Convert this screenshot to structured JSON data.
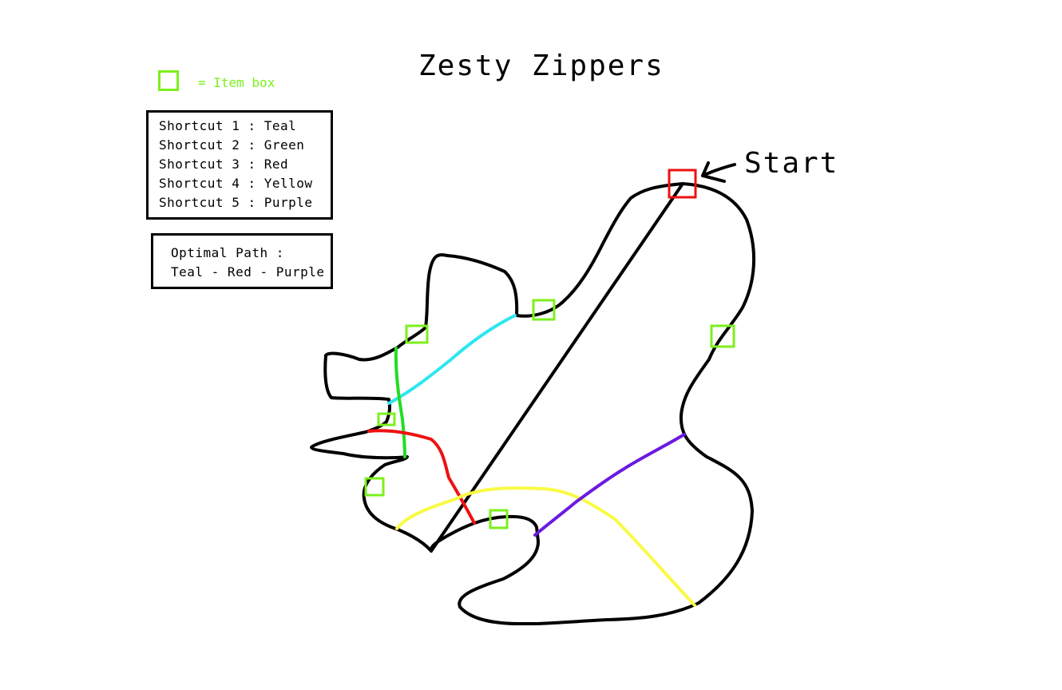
{
  "title": "Zesty Zippers",
  "legend": {
    "swatch_color": "#7cf01d",
    "label": "= Item box"
  },
  "shortcuts": [
    {
      "label": "Shortcut 1 : Teal",
      "color": "#2ee6f0"
    },
    {
      "label": "Shortcut 2 : Green",
      "color": "#22dd22"
    },
    {
      "label": "Shortcut 3 : Red",
      "color": "#ee1111"
    },
    {
      "label": "Shortcut 4 : Yellow",
      "color": "#fafa44"
    },
    {
      "label": "Shortcut 5 : Purple",
      "color": "#6a1be0"
    }
  ],
  "optimal_path": {
    "heading": "Optimal Path :",
    "value": "Teal - Red - Purple"
  },
  "start": {
    "label": "Start",
    "marker_color": "#ee1111"
  },
  "track_color": "#000000"
}
